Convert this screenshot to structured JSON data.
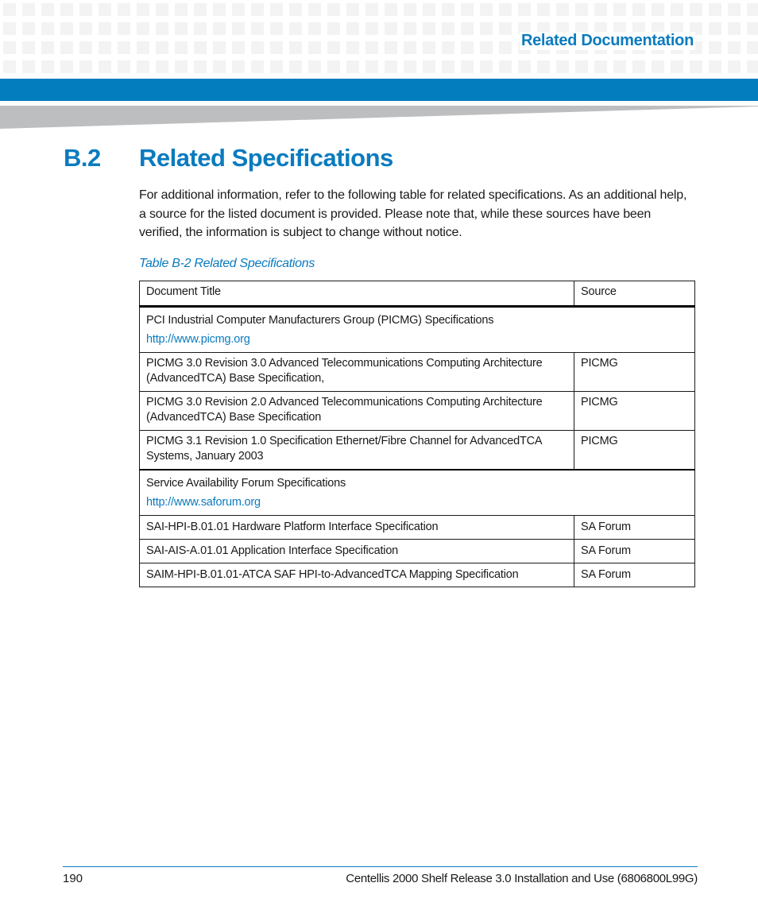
{
  "header": {
    "running_title": "Related Documentation",
    "accent_color": "#0a7bbf",
    "bar_color": "#037dbd"
  },
  "section": {
    "number": "B.2",
    "title": "Related Specifications",
    "intro": "For additional information, refer to the following table for related specifications. As an additional help, a source for the listed document is provided. Please note that, while these sources have been verified, the information is subject to change without notice."
  },
  "table": {
    "caption": "Table B-2 Related Specifications",
    "headers": [
      "Document Title",
      "Source"
    ],
    "groups": [
      {
        "title": "PCI Industrial Computer Manufacturers Group (PICMG) Specifications",
        "link": "http://www.picmg.org",
        "rows": [
          {
            "title": "PICMG 3.0 Revision 3.0 Advanced Telecommunications Computing Architecture (AdvancedTCA) Base Specification,",
            "source": "PICMG"
          },
          {
            "title": "PICMG 3.0 Revision 2.0 Advanced Telecommunications Computing Architecture (AdvancedTCA) Base Specification",
            "source": "PICMG"
          },
          {
            "title": "PICMG 3.1 Revision 1.0 Specification Ethernet/Fibre Channel for AdvancedTCA Systems, January 2003",
            "source": "PICMG"
          }
        ]
      },
      {
        "title": "Service Availability Forum Specifications",
        "link": "http://www.saforum.org",
        "rows": [
          {
            "title": "SAI-HPI-B.01.01 Hardware Platform Interface Specification",
            "source": "SA Forum"
          },
          {
            "title": "SAI-AIS-A.01.01 Application Interface Specification",
            "source": "SA Forum"
          },
          {
            "title": "SAIM-HPI-B.01.01-ATCA SAF HPI-to-AdvancedTCA Mapping Specification",
            "source": "SA Forum"
          }
        ]
      }
    ]
  },
  "footer": {
    "page_number": "190",
    "document_title": "Centellis 2000 Shelf Release 3.0 Installation and Use (6806800L99G)"
  }
}
